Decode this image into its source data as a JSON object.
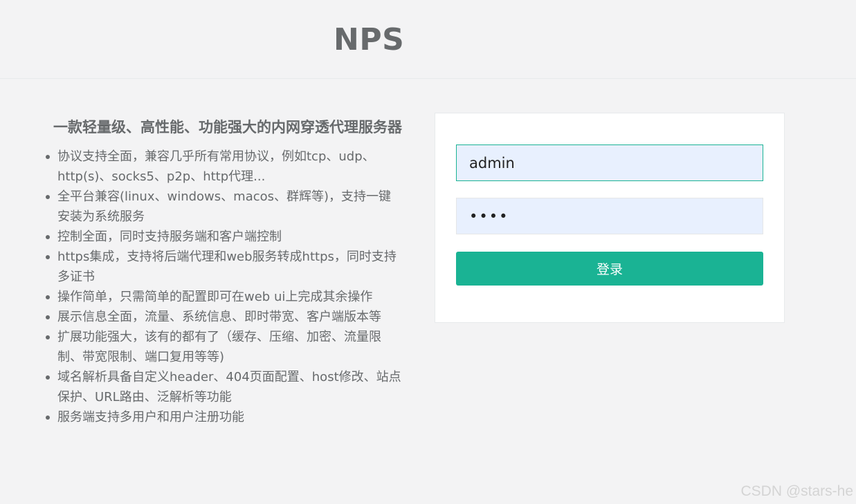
{
  "header": {
    "logo": "NPS"
  },
  "intro": {
    "tagline": "一款轻量级、高性能、功能强大的内网穿透代理服务器",
    "features": [
      "协议支持全面，兼容几乎所有常用协议，例如tcp、udp、http(s)、socks5、p2p、http代理...",
      "全平台兼容(linux、windows、macos、群辉等)，支持一键安装为系统服务",
      "控制全面，同时支持服务端和客户端控制",
      "https集成，支持将后端代理和web服务转成https，同时支持多证书",
      "操作简单，只需简单的配置即可在web ui上完成其余操作",
      "展示信息全面，流量、系统信息、即时带宽、客户端版本等",
      "扩展功能强大，该有的都有了（缓存、压缩、加密、流量限制、带宽限制、端口复用等等)",
      "域名解析具备自定义header、404页面配置、host修改、站点保护、URL路由、泛解析等功能",
      "服务端支持多用户和用户注册功能"
    ]
  },
  "login": {
    "username_value": "admin",
    "password_value": "••••",
    "submit_label": "登录"
  },
  "watermark": "CSDN @stars-he",
  "colors": {
    "accent": "#1ab394",
    "text": "#676a6c",
    "background": "#f3f3f4",
    "input_fill": "#e8f0fe"
  }
}
